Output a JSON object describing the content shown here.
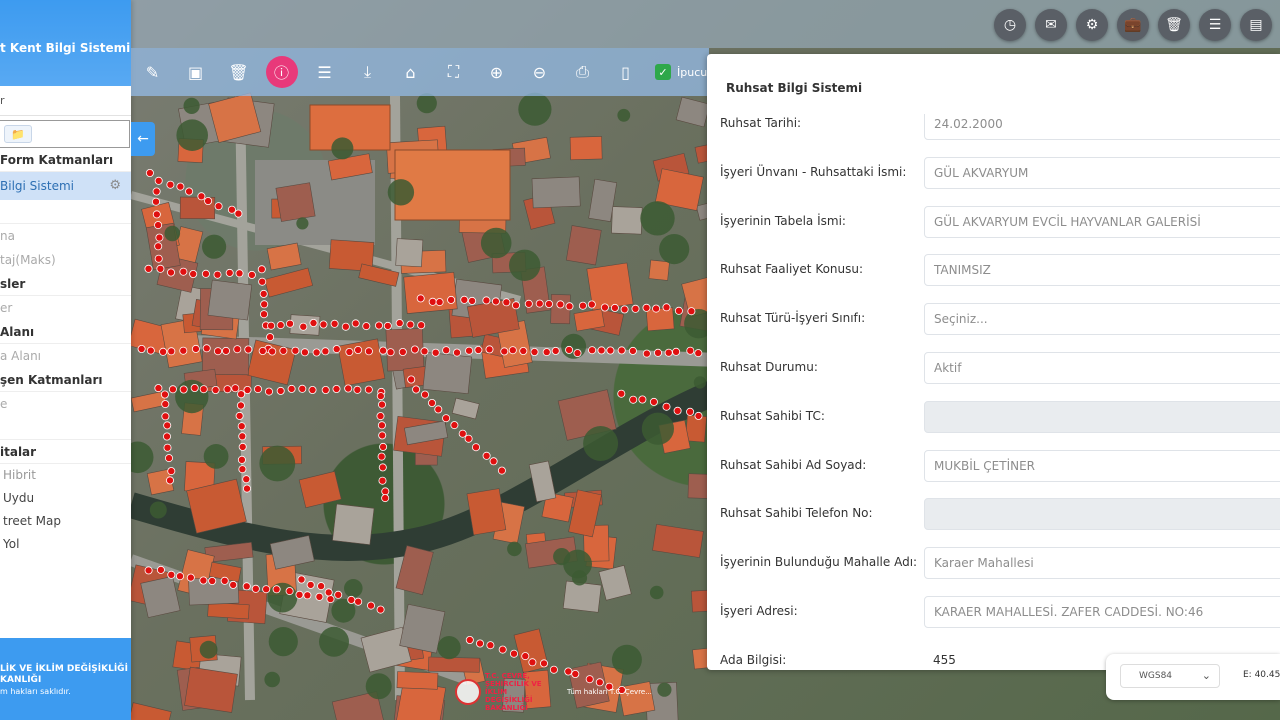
{
  "sidebar": {
    "header_title": "t Kent Bilgi Sistemi",
    "search_value": "r",
    "sections": {
      "form_layers": "Form Katmanları",
      "active_item": "Bilgi Sistemi",
      "item_1": "na",
      "item_2": "taj(Maks)",
      "services": "sler",
      "services_item": "er",
      "area": "Alanı",
      "area_item": "a Alanı",
      "other_layers": "şen Katmanları",
      "other_item": "e",
      "maps": "italar"
    },
    "basemaps": [
      "Hibrit",
      "Uydu",
      "treet Map",
      "Yol"
    ],
    "footer_line1": "LİK VE İKLİM DEĞİŞİKLİĞİ",
    "footer_line2": "KANLIĞI",
    "footer_line3": "m hakları saklıdır."
  },
  "toolbar": {
    "icons": [
      "pencil-icon",
      "select-area-icon",
      "trash-icon",
      "info-icon",
      "list-icon",
      "download-icon",
      "home-icon",
      "fullscreen-icon",
      "zoom-in-icon",
      "zoom-out-icon",
      "print-icon",
      "mobile-icon"
    ],
    "checkbox_label": "İpucu"
  },
  "topright": [
    "clock-icon",
    "mail-icon",
    "settings-icon",
    "briefcase-icon",
    "calendar-icon",
    "menu-icon",
    "map-icon"
  ],
  "panel": {
    "title": "Ruhsat Bilgi Sistemi",
    "fields": [
      {
        "label": "Ruhsat Tarihi:",
        "value": "24.02.2000",
        "style": "input"
      },
      {
        "label": "İşyeri Ünvanı - Ruhsattaki İsmi:",
        "value": "GÜL AKVARYUM",
        "style": "input"
      },
      {
        "label": "İşyerinin Tabela İsmi:",
        "value": "GÜL AKVARYUM EVCİL HAYVANLAR GALERİSİ",
        "style": "input"
      },
      {
        "label": "Ruhsat Faaliyet Konusu:",
        "value": "TANIMSIZ",
        "style": "input"
      },
      {
        "label": "Ruhsat Türü-İşyeri Sınıfı:",
        "value": "Seçiniz...",
        "style": "input"
      },
      {
        "label": "Ruhsat Durumu:",
        "value": "Aktif",
        "style": "input"
      },
      {
        "label": "Ruhsat Sahibi TC:",
        "value": "",
        "style": "gray"
      },
      {
        "label": "Ruhsat Sahibi Ad Soyad:",
        "value": "MUKBİL ÇETİNER",
        "style": "input"
      },
      {
        "label": "Ruhsat Sahibi Telefon No:",
        "value": "",
        "style": "gray"
      },
      {
        "label": "İşyerinin Bulunduğu Mahalle Adı:",
        "value": "Karaer Mahallesi",
        "style": "input"
      },
      {
        "label": "İşyeri Adresi:",
        "value": "KARAER MAHALLESİ. ZAFER CADDESİ. NO:46",
        "style": "input"
      },
      {
        "label": "Ada Bilgisi:",
        "value": "455",
        "style": "plain"
      }
    ]
  },
  "coords": {
    "projection": "WGS84",
    "value": "E: 40.45"
  },
  "attribution": {
    "org_line": "T.C. ÇEVRE, ŞEHİRCİLİK VE İKLİM DEĞİŞİKLİĞİ BAKANLIĞI",
    "copyright": "Tüm hakları T.C. Çevre..."
  },
  "colors": {
    "sidebar_blue": "#3d9bf0",
    "active_pink": "#e8397a",
    "marker_red": "#e01010"
  }
}
